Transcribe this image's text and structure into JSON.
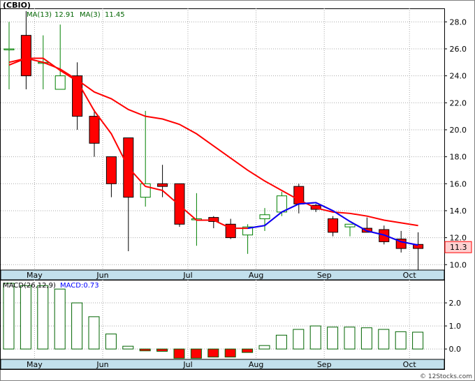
{
  "colors": {
    "down": "#ff0000",
    "up": "#ffffff",
    "wick_up": "#008000",
    "wick_down": "#000000",
    "ma_slow": "#ff0000",
    "ma_fast": "#0000ff",
    "macd_bar_pos": "#ffffff",
    "macd_bar_neg": "#ff0000",
    "macd_bar_stroke": "#006400",
    "axis_band": "#c2e0ec",
    "grid": "#a9a9a9",
    "legend_text": "#006400",
    "last_price_box": "#ffd0d0"
  },
  "header": {
    "symbol": "(CBIO)",
    "ma_slow_label": "MA(13)",
    "ma_slow_value": "12.91",
    "ma_fast_label": "MA(3)",
    "ma_fast_value": "11.45"
  },
  "macd_header": {
    "label": "MACD(26,12,9)",
    "value_label": "MACD:0.73"
  },
  "watermark": "© 12Stocks.com",
  "last_price": "11.3",
  "chart_data": [
    {
      "type": "candlestick",
      "x_labels": [
        "May",
        "Jun",
        "Jul",
        "Aug",
        "Sep",
        "Oct"
      ],
      "x_label_positions": [
        1,
        5,
        10,
        14,
        18,
        23
      ],
      "ylim": [
        9.6,
        29.0
      ],
      "yticks": [
        10.0,
        12.0,
        14.0,
        16.0,
        18.0,
        20.0,
        22.0,
        24.0,
        26.0,
        28.0
      ],
      "grid": true,
      "candles": [
        {
          "open": 26.0,
          "high": 28.0,
          "low": 23.0,
          "close": 26.0
        },
        {
          "open": 27.0,
          "high": 28.8,
          "low": 23.0,
          "close": 24.0
        },
        {
          "open": 25.0,
          "high": 27.0,
          "low": 23.0,
          "close": 25.0
        },
        {
          "open": 23.0,
          "high": 27.8,
          "low": 23.0,
          "close": 24.0
        },
        {
          "open": 24.0,
          "high": 25.0,
          "low": 20.0,
          "close": 21.0
        },
        {
          "open": 21.0,
          "high": 21.5,
          "low": 18.0,
          "close": 19.0
        },
        {
          "open": 18.0,
          "high": 18.0,
          "low": 15.0,
          "close": 16.0
        },
        {
          "open": 19.4,
          "high": 19.4,
          "low": 11.0,
          "close": 15.0
        },
        {
          "open": 15.0,
          "high": 21.4,
          "low": 14.3,
          "close": 16.0
        },
        {
          "open": 16.0,
          "high": 17.4,
          "low": 15.0,
          "close": 15.8
        },
        {
          "open": 16.0,
          "high": 16.0,
          "low": 12.8,
          "close": 13.0
        },
        {
          "open": 13.4,
          "high": 15.3,
          "low": 11.4,
          "close": 13.4
        },
        {
          "open": 13.5,
          "high": 13.6,
          "low": 12.7,
          "close": 13.2
        },
        {
          "open": 13.0,
          "high": 13.4,
          "low": 11.9,
          "close": 12.0
        },
        {
          "open": 12.2,
          "high": 13.0,
          "low": 10.8,
          "close": 12.8
        },
        {
          "open": 13.4,
          "high": 14.2,
          "low": 12.5,
          "close": 13.7
        },
        {
          "open": 13.9,
          "high": 15.4,
          "low": 13.6,
          "close": 15.1
        },
        {
          "open": 15.8,
          "high": 16.0,
          "low": 13.8,
          "close": 14.5
        },
        {
          "open": 14.4,
          "high": 14.5,
          "low": 13.9,
          "close": 14.1
        },
        {
          "open": 13.4,
          "high": 13.6,
          "low": 12.1,
          "close": 12.4
        },
        {
          "open": 12.8,
          "high": 13.0,
          "low": 12.1,
          "close": 13.0
        },
        {
          "open": 12.7,
          "high": 13.5,
          "low": 12.4,
          "close": 12.4
        },
        {
          "open": 12.6,
          "high": 12.9,
          "low": 11.5,
          "close": 11.7
        },
        {
          "open": 11.9,
          "high": 12.5,
          "low": 10.9,
          "close": 11.2
        },
        {
          "open": 11.5,
          "high": 12.4,
          "low": 9.6,
          "close": 11.2
        }
      ],
      "series": [
        {
          "name": "MA(13)",
          "color": "#ff0000",
          "start_index": 0,
          "values": [
            25.0,
            25.3,
            25.0,
            24.5,
            23.7,
            22.8,
            22.3,
            21.5,
            21.0,
            20.8,
            20.4,
            19.7,
            18.8,
            17.9,
            17.0,
            16.2,
            15.5,
            14.8,
            14.2,
            13.9,
            13.8,
            13.6,
            13.3,
            13.1,
            12.9
          ]
        },
        {
          "name": "MA(3)",
          "color": "#0000ff",
          "start_index": 0,
          "values": [
            24.8,
            25.3,
            25.3,
            24.4,
            23.6,
            21.4,
            19.7,
            17.2,
            15.8,
            15.5,
            14.4,
            13.3,
            13.3,
            12.7,
            12.7,
            12.9,
            13.9,
            14.5,
            14.6,
            14.0,
            13.2,
            12.5,
            12.2,
            11.7,
            11.45
          ],
          "visible_from": 14,
          "drawn_over_from": 0
        }
      ]
    },
    {
      "type": "bar",
      "title": "MACD(26,12,9)",
      "x_labels": [
        "May",
        "Jun",
        "Jul",
        "Aug",
        "Sep",
        "Oct"
      ],
      "x_label_positions": [
        1,
        5,
        10,
        14,
        18,
        23
      ],
      "ylim": [
        -0.45,
        3.0
      ],
      "yticks": [
        0.0,
        1.0,
        2.0
      ],
      "grid": true,
      "values": [
        2.85,
        2.75,
        2.75,
        2.6,
        2.0,
        1.4,
        0.65,
        0.12,
        -0.08,
        -0.1,
        -0.4,
        -0.4,
        -0.35,
        -0.35,
        -0.15,
        0.15,
        0.6,
        0.85,
        1.0,
        0.95,
        0.95,
        0.92,
        0.85,
        0.75,
        0.73
      ]
    }
  ]
}
